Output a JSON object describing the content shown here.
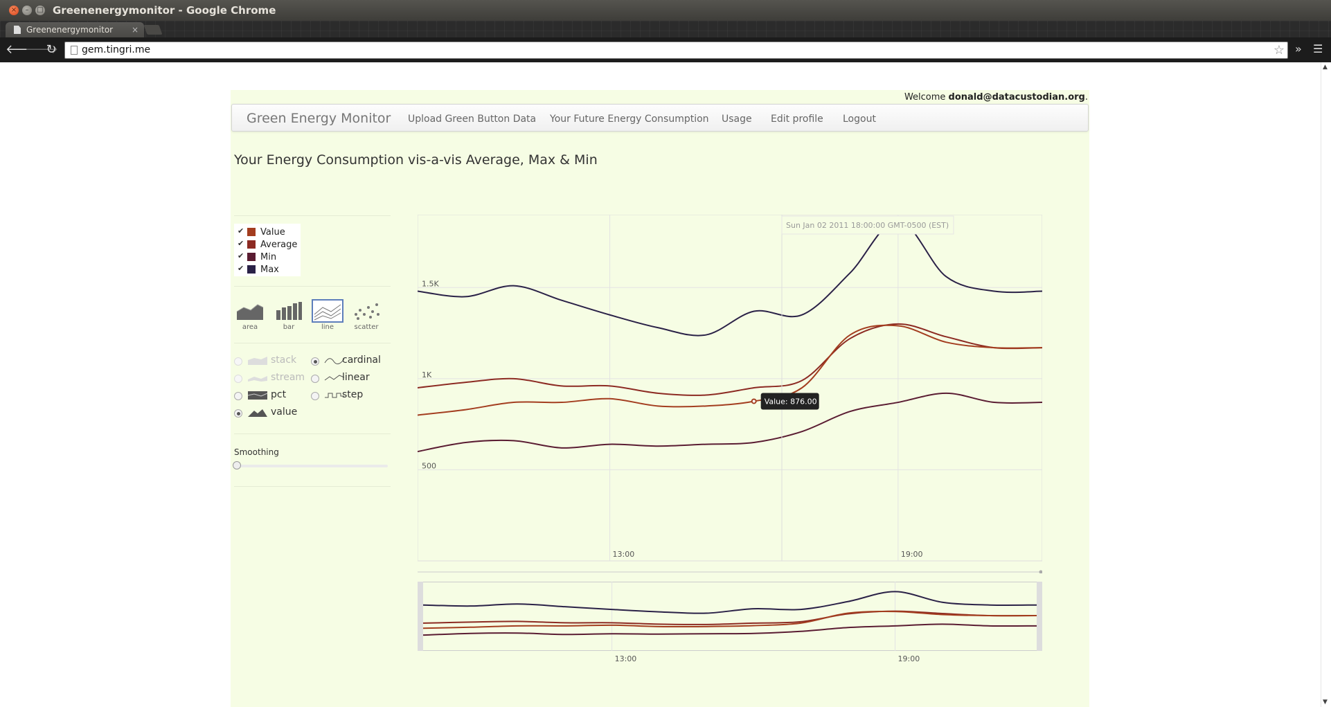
{
  "window": {
    "title": "Greenenergymonitor - Google Chrome",
    "tab_title": "Greenenergymonitor",
    "url": "gem.tingri.me"
  },
  "page": {
    "welcome_prefix": "Welcome",
    "welcome_user": "donald@datacustodian.org",
    "welcome_suffix": ".",
    "brand": "Green Energy Monitor",
    "nav": [
      "Upload Green Button Data",
      "Your Future Energy Consumption",
      "Usage",
      "Edit profile",
      "Logout"
    ],
    "heading": "Your Energy Consumption vis-a-vis Average, Max & Min"
  },
  "legend": [
    {
      "label": "Value",
      "color": "#a33d1f"
    },
    {
      "label": "Average",
      "color": "#8c2a22"
    },
    {
      "label": "Min",
      "color": "#5a1c32"
    },
    {
      "label": "Max",
      "color": "#2a2147"
    }
  ],
  "renderers": [
    {
      "label": "area",
      "icon": "area-chart-icon"
    },
    {
      "label": "bar",
      "icon": "bar-chart-icon"
    },
    {
      "label": "line",
      "icon": "line-chart-icon",
      "active": true
    },
    {
      "label": "scatter",
      "icon": "scatter-chart-icon"
    }
  ],
  "offset_options": [
    {
      "label": "stack",
      "icon": "stack-icon",
      "selected": false,
      "disabled": true
    },
    {
      "label": "stream",
      "icon": "stream-icon",
      "selected": false,
      "disabled": true
    },
    {
      "label": "pct",
      "icon": "pct-icon",
      "selected": false,
      "disabled": false
    },
    {
      "label": "value",
      "icon": "value-icon",
      "selected": true,
      "disabled": false
    }
  ],
  "interpolation_options": [
    {
      "label": "cardinal",
      "icon": "cardinal-icon",
      "selected": true
    },
    {
      "label": "linear",
      "icon": "linear-icon",
      "selected": false
    },
    {
      "label": "step",
      "icon": "step-icon",
      "selected": false
    }
  ],
  "smoothing": {
    "label": "Smoothing",
    "value": 0
  },
  "chart_data": {
    "type": "line",
    "x_ticks": [
      "13:00",
      "19:00"
    ],
    "y_ticks": [
      "500",
      "1K",
      "1.5K"
    ],
    "ylim": [
      0,
      1900
    ],
    "x": [
      9,
      10,
      11,
      12,
      13,
      14,
      15,
      16,
      17,
      18,
      19,
      20,
      21,
      22
    ],
    "series": [
      {
        "name": "Max",
        "color": "#2a2147",
        "values": [
          1480,
          1450,
          1510,
          1430,
          1350,
          1280,
          1240,
          1370,
          1350,
          1580,
          1870,
          1560,
          1480,
          1480
        ]
      },
      {
        "name": "Average",
        "color": "#8c2a22",
        "values": [
          950,
          980,
          1000,
          960,
          960,
          920,
          910,
          950,
          990,
          1220,
          1300,
          1230,
          1170,
          1170
        ]
      },
      {
        "name": "Value",
        "color": "#a33d1f",
        "values": [
          800,
          830,
          870,
          870,
          890,
          850,
          850,
          876,
          950,
          1240,
          1290,
          1200,
          1170,
          1170
        ]
      },
      {
        "name": "Min",
        "color": "#5a1c32",
        "values": [
          600,
          650,
          660,
          620,
          640,
          630,
          640,
          650,
          710,
          820,
          870,
          920,
          870,
          870
        ]
      }
    ],
    "annotation": "Sun Jan 02 2011 18:00:00 GMT-0500 (EST)",
    "tooltip": "Value: 876.00",
    "grid": true
  }
}
